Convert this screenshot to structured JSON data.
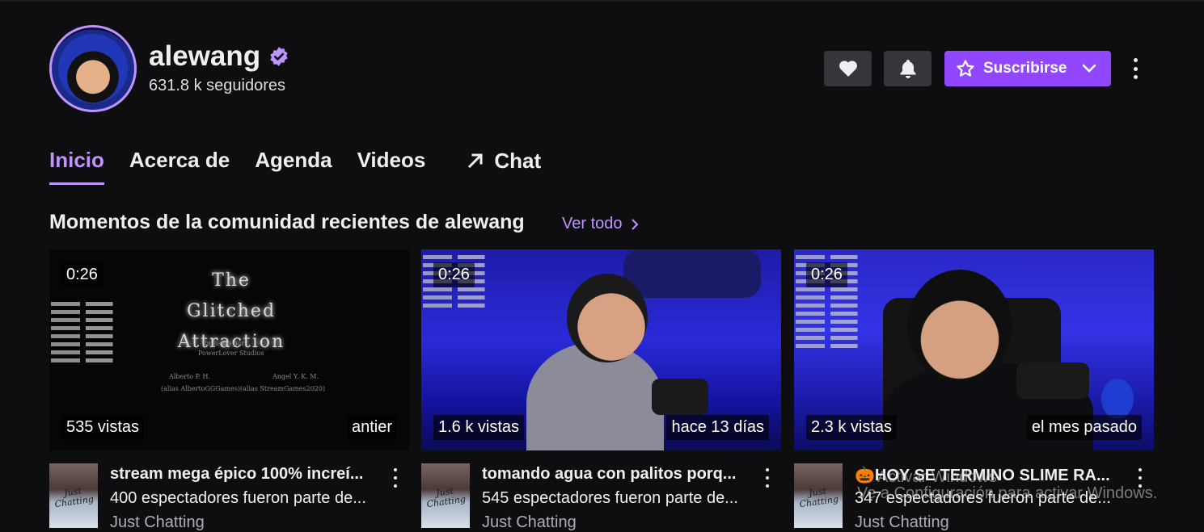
{
  "channel": {
    "name": "alewang",
    "followers": "631.8 k seguidores"
  },
  "actions": {
    "subscribe_label": "Suscribirse"
  },
  "tabs": [
    {
      "label": "Inicio",
      "active": true
    },
    {
      "label": "Acerca de"
    },
    {
      "label": "Agenda"
    },
    {
      "label": "Videos"
    },
    {
      "label": "Chat"
    }
  ],
  "section": {
    "title": "Momentos de la comunidad recientes de alewang",
    "see_all": "Ver todo"
  },
  "clips": [
    {
      "duration": "0:26",
      "views": "535 vistas",
      "date": "antier",
      "title": "stream mega épico 100% increí...",
      "subtitle": "400 espectadores fueron parte de...",
      "category": "Just Chatting",
      "thumb_text": "The Glitched Attraction"
    },
    {
      "duration": "0:26",
      "views": "1.6 k vistas",
      "date": "hace 13 días",
      "title": "tomando agua con palitos porq...",
      "subtitle": "545 espectadores fueron parte de...",
      "category": "Just Chatting"
    },
    {
      "duration": "0:26",
      "views": "2.3 k vistas",
      "date": "el mes pasado",
      "title": "🎃HOY SE TERMINO SLIME RA...",
      "subtitle": "347 espectadores fueron parte de...",
      "category": "Just Chatting"
    }
  ],
  "category_art_label": "Just Chatting",
  "watermark": {
    "line1": "Activar Windows",
    "line2": "Ve a Configuración para activar Windows."
  },
  "colors": {
    "accent": "#9147ff",
    "accent_text": "#bf94ff",
    "background": "#0e0e10"
  },
  "icons": [
    "heart-icon",
    "bell-icon",
    "star-icon",
    "chevron-down-icon",
    "more-vertical-icon",
    "external-arrow-icon",
    "verified-badge-icon",
    "chevron-right-icon"
  ]
}
